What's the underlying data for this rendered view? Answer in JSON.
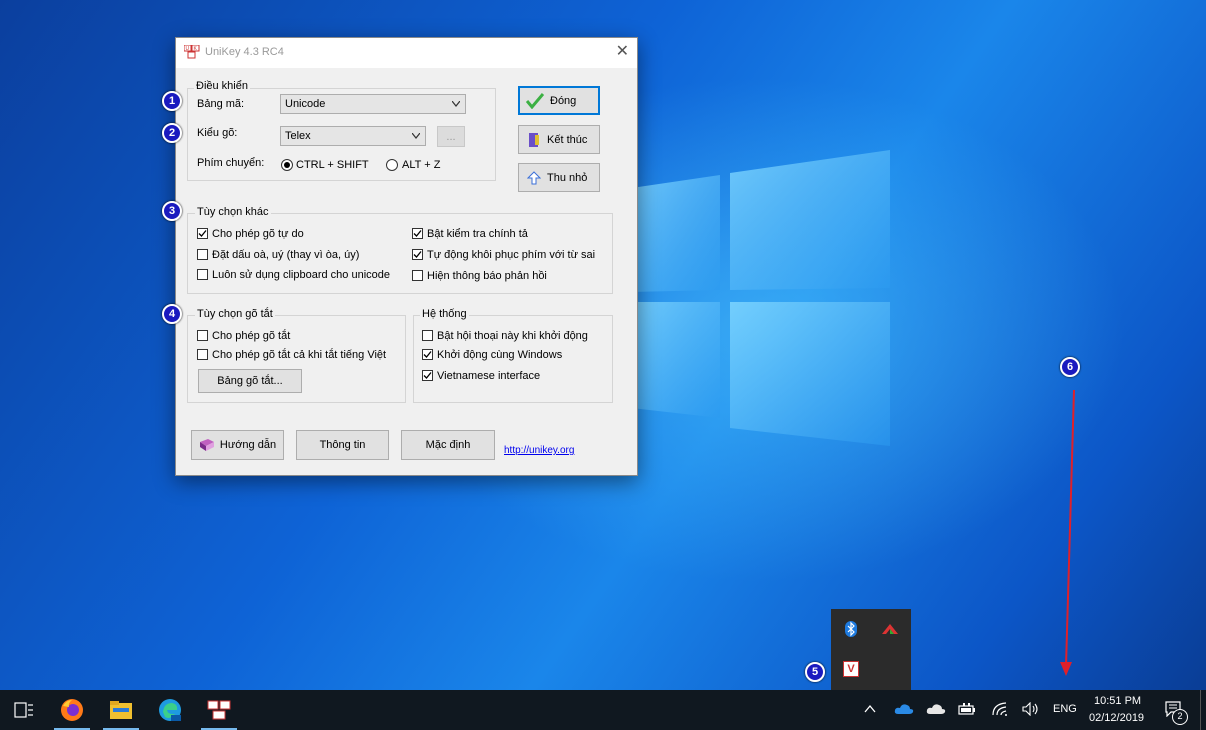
{
  "window": {
    "title": "UniKey 4.3 RC4",
    "close_glyph": "✕"
  },
  "control": {
    "legend": "Điều khiển",
    "charset_label": "Bảng mã:",
    "charset_value": "Unicode",
    "input_method_label": "Kiểu gõ:",
    "input_method_value": "Telex",
    "more_button": "...",
    "switch_key_label": "Phím chuyển:",
    "switch_ctrl_shift": "CTRL + SHIFT",
    "switch_alt_z": "ALT + Z",
    "switch_selected": "CTRL + SHIFT"
  },
  "buttons": {
    "close": "Đóng",
    "exit": "Kết thúc",
    "minimize": "Thu nhỏ",
    "help": "Hướng dẫn",
    "info": "Thông tin",
    "default": "Mặc định",
    "shortcut_table": "Bảng gõ tắt..."
  },
  "other_options": {
    "legend": "Tùy chọn khác",
    "items": [
      {
        "label": "Cho phép gõ tự do",
        "checked": true
      },
      {
        "label": "Đặt dấu oà, uý (thay vì òa, úy)",
        "checked": false
      },
      {
        "label": "Luôn sử dụng clipboard cho unicode",
        "checked": false
      },
      {
        "label": "Bật kiểm tra chính tả",
        "checked": true
      },
      {
        "label": "Tự động khôi phục phím với từ sai",
        "checked": true
      },
      {
        "label": "Hiện thông báo phản hồi",
        "checked": false
      }
    ]
  },
  "shortcut_options": {
    "legend": "Tùy chọn gõ tắt",
    "items": [
      {
        "label": "Cho phép gõ tắt",
        "checked": false
      },
      {
        "label": "Cho phép gõ tắt cả khi tắt tiếng Việt",
        "checked": false
      }
    ]
  },
  "system_options": {
    "legend": "Hệ thống",
    "items": [
      {
        "label": "Bật hội thoại này khi khởi động",
        "checked": false
      },
      {
        "label": "Khởi động cùng Windows",
        "checked": true
      },
      {
        "label": "Vietnamese interface",
        "checked": true
      }
    ]
  },
  "link": "http://unikey.org",
  "markers": [
    "1",
    "2",
    "3",
    "4",
    "5",
    "6"
  ],
  "taskbar": {
    "apps": [
      "task-view-icon",
      "firefox-icon",
      "file-explorer-icon",
      "edge-icon",
      "unikey-icon"
    ],
    "language": "ENG",
    "time": "10:51 PM",
    "date": "02/12/2019",
    "notification_count": "2"
  },
  "tray_popup": {
    "icons": [
      "bluetooth-icon",
      "nvidia-icon",
      "unikey-v-icon"
    ],
    "unikey_letter": "V"
  },
  "colors": {
    "marker_fill": "#1a1abf",
    "arrow": "#e0202a",
    "accent": "#0078d7",
    "checkmark_green": "#3cb043"
  }
}
